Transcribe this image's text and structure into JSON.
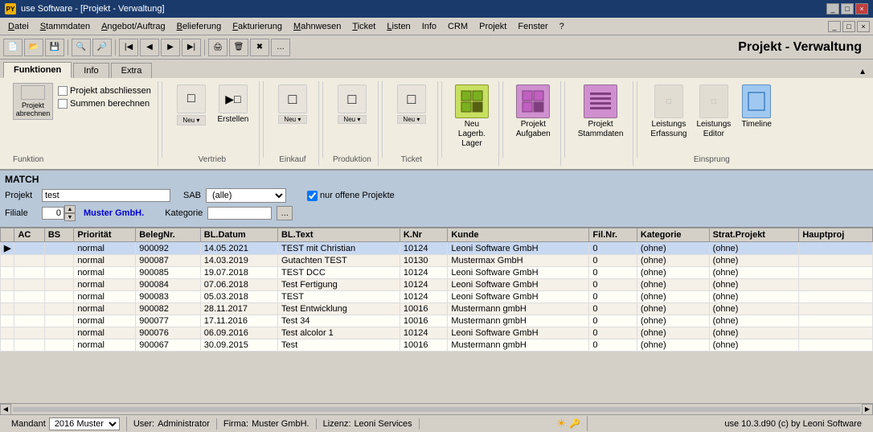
{
  "titlebar": {
    "icon": "PY",
    "title": "use Software - [Projekt - Verwaltung]",
    "controls": [
      "_",
      "□",
      "×"
    ]
  },
  "menubar": {
    "items": [
      "Datei",
      "Stammdaten",
      "Angebot/Auftrag",
      "Belieferung",
      "Fakturierung",
      "Mahnwesen",
      "Ticket",
      "Listen",
      "Info",
      "CRM",
      "Projekt",
      "Fenster",
      "?"
    ]
  },
  "toolbar_title": "Projekt - Verwaltung",
  "tabs": {
    "items": [
      "Funktionen",
      "Info",
      "Extra"
    ],
    "active": "Funktionen"
  },
  "ribbon": {
    "groups": [
      {
        "label": "",
        "buttons": [
          {
            "id": "projekt-abrechnen",
            "label": "Projekt\nabrechnen",
            "icon": "□",
            "type": "big"
          },
          {
            "id": "projekt-abschliessen",
            "label": "Projekt abschliessen",
            "checkbox": true
          },
          {
            "id": "summen-berechnen",
            "label": "Summen berechnen",
            "checkbox": true
          }
        ]
      },
      {
        "label": "Funktion",
        "buttons": [
          {
            "id": "neu-vertrieb",
            "label": "Neu\n–",
            "icon": "□",
            "type": "split"
          }
        ]
      },
      {
        "label": "Vertrieb",
        "buttons": [
          {
            "id": "erstellen",
            "label": "Erstellen",
            "icon": "▶□",
            "type": "normal"
          }
        ]
      },
      {
        "label": "Einkauf",
        "buttons": [
          {
            "id": "neu-einkauf",
            "label": "Neu\n–",
            "icon": "□",
            "type": "split"
          }
        ]
      },
      {
        "label": "Produktion",
        "buttons": [
          {
            "id": "neu-produktion",
            "label": "Neu\n–",
            "icon": "□",
            "type": "split"
          }
        ]
      },
      {
        "label": "Ticket",
        "buttons": [
          {
            "id": "neu-ticket",
            "label": "Neu\nTicket",
            "icon": "□",
            "type": "split"
          }
        ]
      },
      {
        "label": "",
        "buttons": [
          {
            "id": "neu-lagerb-lager",
            "label": "Neu\nLagerb.\nLager",
            "icon": "⊞",
            "type": "highlight"
          }
        ]
      },
      {
        "label": "",
        "buttons": [
          {
            "id": "projekt-aufgaben",
            "label": "Projekt\nAufgaben",
            "icon": "⊞",
            "type": "purple"
          }
        ]
      },
      {
        "label": "",
        "buttons": [
          {
            "id": "projekt-stammdaten",
            "label": "Projekt\nStammdaten",
            "icon": "≡≡",
            "type": "purple"
          }
        ]
      },
      {
        "label": "Einsprung",
        "buttons": [
          {
            "id": "leistungs-erfassung",
            "label": "Leistungs\nErfassung",
            "icon": "□",
            "type": "disabled"
          },
          {
            "id": "leistungs-editor",
            "label": "Leistungs\nEditor",
            "icon": "□",
            "type": "disabled"
          },
          {
            "id": "timeline",
            "label": "Timeline",
            "icon": "□",
            "type": "blue-light"
          }
        ]
      }
    ]
  },
  "match": {
    "title": "MATCH",
    "fields": {
      "projekt_label": "Projekt",
      "projekt_value": "test",
      "sab_label": "SAB",
      "sab_value": "(alle)",
      "nur_offene_label": "nur offene Projekte",
      "filiale_label": "Filiale",
      "filiale_value": "0",
      "filiale_name": "Muster GmbH.",
      "kategorie_label": "Kategorie"
    }
  },
  "table": {
    "columns": [
      "AC",
      "BS",
      "Priorität",
      "BelegNr.",
      "BL.Datum",
      "BL.Text",
      "K.Nr",
      "Kunde",
      "Fil.Nr.",
      "Kategorie",
      "Strat.Projekt",
      "Hauptproj"
    ],
    "rows": [
      {
        "ac": "",
        "bs": "",
        "prioritaet": "normal",
        "belegNr": "900092",
        "blDatum": "14.05.2021",
        "blText": "TEST mit Christian",
        "kNr": "10124",
        "kunde": "Leoni Software GmbH",
        "filNr": "0",
        "kategorie": "(ohne)",
        "stratProjekt": "(ohne)",
        "hauptproj": "",
        "selected": true
      },
      {
        "ac": "",
        "bs": "",
        "prioritaet": "normal",
        "belegNr": "900087",
        "blDatum": "14.03.2019",
        "blText": "Gutachten TEST",
        "kNr": "10130",
        "kunde": "Mustermax GmbH",
        "filNr": "0",
        "kategorie": "(ohne)",
        "stratProjekt": "(ohne)",
        "hauptproj": ""
      },
      {
        "ac": "",
        "bs": "",
        "prioritaet": "normal",
        "belegNr": "900085",
        "blDatum": "19.07.2018",
        "blText": "TEST DCC",
        "kNr": "10124",
        "kunde": "Leoni Software GmbH",
        "filNr": "0",
        "kategorie": "(ohne)",
        "stratProjekt": "(ohne)",
        "hauptproj": ""
      },
      {
        "ac": "",
        "bs": "",
        "prioritaet": "normal",
        "belegNr": "900084",
        "blDatum": "07.06.2018",
        "blText": "Test Fertigung",
        "kNr": "10124",
        "kunde": "Leoni Software GmbH",
        "filNr": "0",
        "kategorie": "(ohne)",
        "stratProjekt": "(ohne)",
        "hauptproj": ""
      },
      {
        "ac": "",
        "bs": "",
        "prioritaet": "normal",
        "belegNr": "900083",
        "blDatum": "05.03.2018",
        "blText": "TEST",
        "kNr": "10124",
        "kunde": "Leoni Software GmbH",
        "filNr": "0",
        "kategorie": "(ohne)",
        "stratProjekt": "(ohne)",
        "hauptproj": ""
      },
      {
        "ac": "",
        "bs": "",
        "prioritaet": "normal",
        "belegNr": "900082",
        "blDatum": "28.11.2017",
        "blText": "Test Entwicklung",
        "kNr": "10016",
        "kunde": "Mustermann gmbH",
        "filNr": "0",
        "kategorie": "(ohne)",
        "stratProjekt": "(ohne)",
        "hauptproj": ""
      },
      {
        "ac": "",
        "bs": "",
        "prioritaet": "normal",
        "belegNr": "900077",
        "blDatum": "17.11.2016",
        "blText": "Test 34",
        "kNr": "10016",
        "kunde": "Mustermann gmbH",
        "filNr": "0",
        "kategorie": "(ohne)",
        "stratProjekt": "(ohne)",
        "hauptproj": ""
      },
      {
        "ac": "",
        "bs": "",
        "prioritaet": "normal",
        "belegNr": "900076",
        "blDatum": "06.09.2016",
        "blText": "Test alcolor 1",
        "kNr": "10124",
        "kunde": "Leoni Software GmbH",
        "filNr": "0",
        "kategorie": "(ohne)",
        "stratProjekt": "(ohne)",
        "hauptproj": ""
      },
      {
        "ac": "",
        "bs": "",
        "prioritaet": "normal",
        "belegNr": "900067",
        "blDatum": "30.09.2015",
        "blText": "Test",
        "kNr": "10016",
        "kunde": "Mustermann gmbH",
        "filNr": "0",
        "kategorie": "(ohne)",
        "stratProjekt": "(ohne)",
        "hauptproj": ""
      }
    ]
  },
  "statusbar": {
    "mandant_label": "Mandant",
    "mandant_value": "2016 Muster",
    "user_label": "User:",
    "user_value": "Administrator",
    "firma_label": "Firma:",
    "firma_value": "Muster GmbH.",
    "lizenz_label": "Lizenz:",
    "lizenz_value": "Leoni Services",
    "version": "use 10.3.d90 (c) by Leoni Software"
  }
}
